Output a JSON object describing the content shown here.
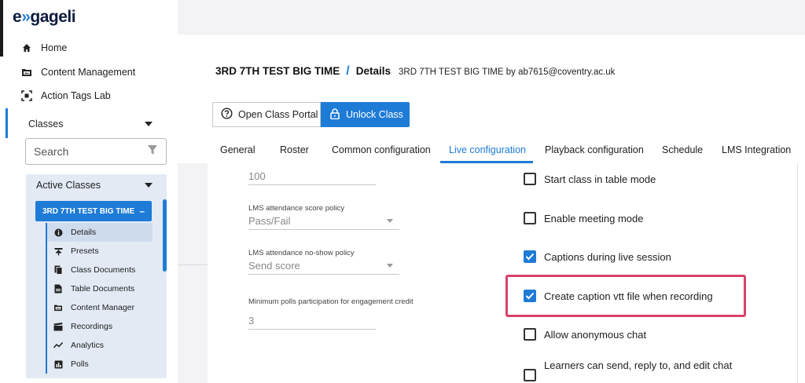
{
  "app": {
    "logo_prefix": "e",
    "logo_accent": "»",
    "logo_suffix": "gageli"
  },
  "sidebar": {
    "nav": [
      {
        "label": "Home",
        "icon": "home-icon"
      },
      {
        "label": "Content Management",
        "icon": "folder-icon"
      },
      {
        "label": "Action Tags Lab",
        "icon": "scan-icon"
      }
    ],
    "classes_label": "Classes",
    "search_placeholder": "Search",
    "active_classes_label": "Active Classes",
    "current_class": "3RD 7TH TEST BIG TIME",
    "collapse_symbol": "–",
    "sub_items": [
      {
        "label": "Details",
        "icon": "info-icon",
        "selected": true
      },
      {
        "label": "Presets",
        "icon": "preset-icon"
      },
      {
        "label": "Class Documents",
        "icon": "documents-icon"
      },
      {
        "label": "Table Documents",
        "icon": "document-icon"
      },
      {
        "label": "Content Manager",
        "icon": "folder-icon"
      },
      {
        "label": "Recordings",
        "icon": "clapper-icon"
      },
      {
        "label": "Analytics",
        "icon": "chart-icon"
      },
      {
        "label": "Polls",
        "icon": "poll-icon"
      }
    ]
  },
  "header": {
    "class_name": "3RD 7TH TEST BIG TIME",
    "separator": "/",
    "page": "Details",
    "owner": "3RD 7TH TEST BIG TIME by ab7615@coventry.ac.uk",
    "open_portal_label": "Open Class Portal",
    "unlock_label": "Unlock Class"
  },
  "tabs": [
    {
      "label": "General"
    },
    {
      "label": "Roster"
    },
    {
      "label": "Common configuration"
    },
    {
      "label": "Live configuration",
      "active": true
    },
    {
      "label": "Playback configuration"
    },
    {
      "label": "Schedule"
    },
    {
      "label": "LMS Integration"
    }
  ],
  "fields": {
    "first_value": "100",
    "score_policy_label": "LMS attendance score policy",
    "score_policy_value": "Pass/Fail",
    "noshow_policy_label": "LMS attendance no-show policy",
    "noshow_policy_value": "Send score",
    "polls_label": "Minimum polls participation for engagement credit",
    "polls_value": "3"
  },
  "checkboxes": [
    {
      "label": "Start class in table mode",
      "checked": false
    },
    {
      "label": "Enable meeting mode",
      "checked": false
    },
    {
      "label": "Captions during live session",
      "checked": true
    },
    {
      "label": "Create caption vtt file when recording",
      "checked": true
    },
    {
      "label": "Allow anonymous chat",
      "checked": false
    },
    {
      "label": "Learners can send, reply to, and edit chat",
      "checked": false
    }
  ],
  "colors": {
    "accent": "#1e7bd6",
    "highlight": "#d9426a"
  }
}
